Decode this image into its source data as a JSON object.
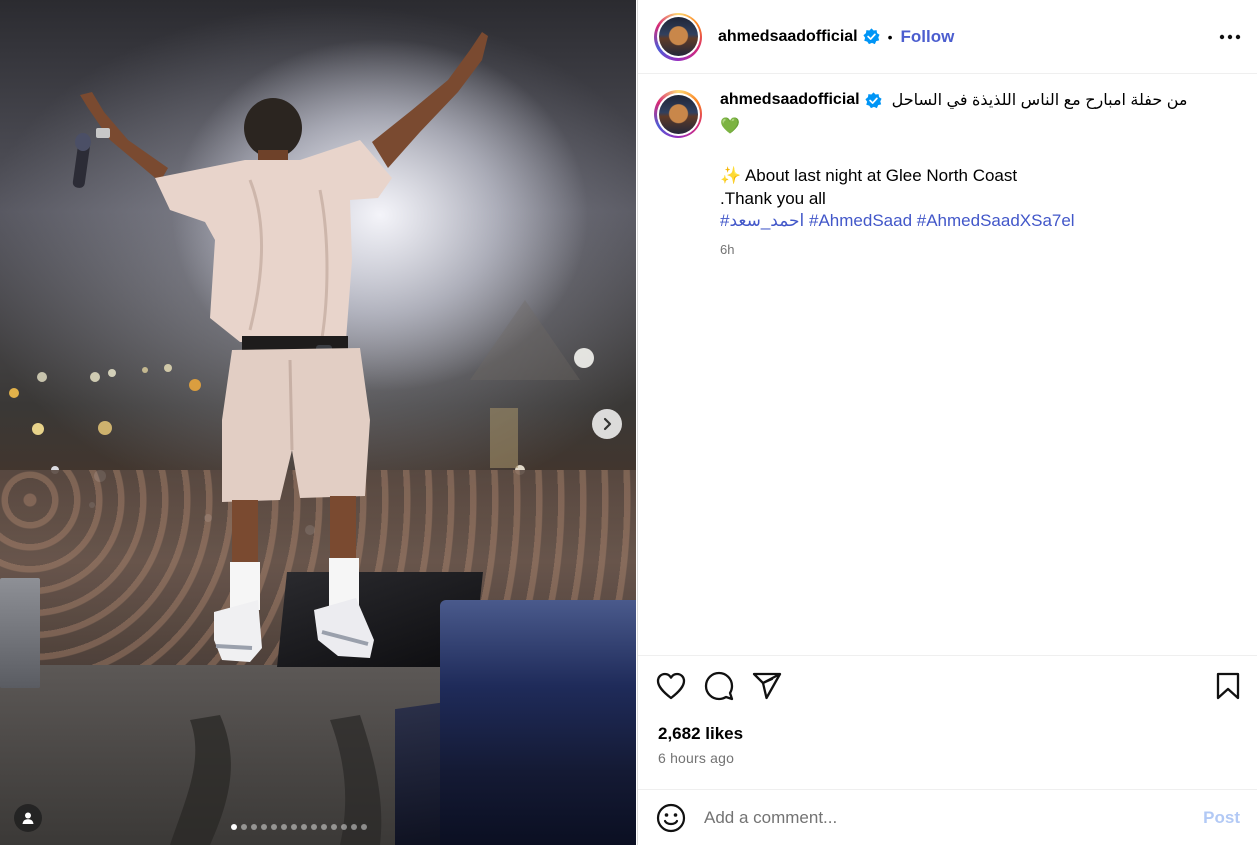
{
  "post": {
    "author": {
      "username": "ahmedsaadofficial",
      "verified": true,
      "follow_label": "Follow",
      "separator": "•"
    },
    "media": {
      "carousel_count": 14,
      "active_index": 0
    },
    "caption": {
      "arabic_text": "من حفلة امبارح مع الناس اللذيذة في الساحل",
      "emoji_line": "💚",
      "line1": "✨  About last night at Glee North Coast",
      "line2": ".Thank you all",
      "hashtags": "#احمد_سعد #AhmedSaad #AhmedSaadXSa7el",
      "time": "6h"
    },
    "stats": {
      "likes": "2,682 likes",
      "time_ago": "6 hours ago"
    },
    "comment": {
      "placeholder": "Add a comment...",
      "post_label": "Post"
    }
  },
  "colors": {
    "link": "#4257c9",
    "follow": "#4c5ecf",
    "post_disabled": "#b2c9f5",
    "verified": "#0095f6"
  },
  "icons": [
    "next-arrow-icon",
    "user-tag-icon",
    "verified-badge-icon",
    "more-options-icon",
    "heart-icon",
    "comment-icon",
    "share-icon",
    "bookmark-icon",
    "emoji-icon"
  ]
}
